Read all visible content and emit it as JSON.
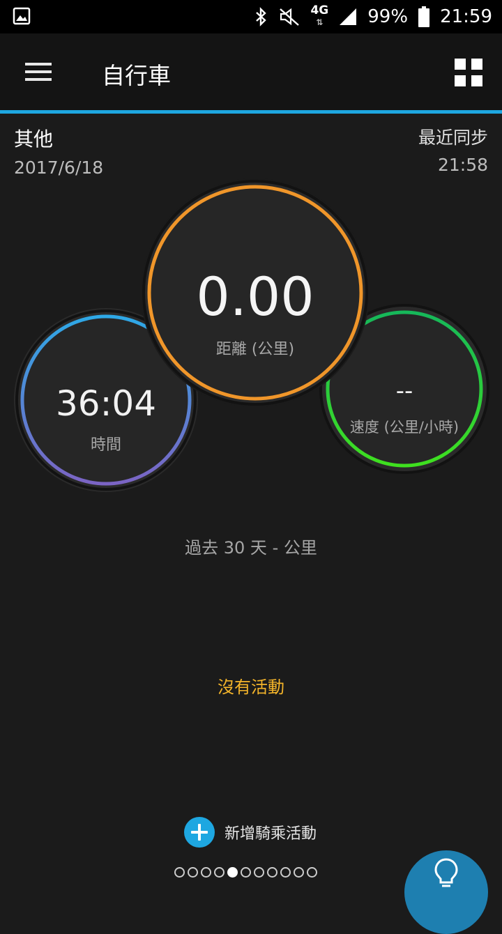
{
  "status_bar": {
    "network": "4G",
    "battery": "99%",
    "time": "21:59"
  },
  "app_bar": {
    "title": "自行車"
  },
  "summary": {
    "category": "其他",
    "date": "2017/6/18",
    "sync_label": "最近同步",
    "sync_time": "21:58"
  },
  "metrics": {
    "distance": {
      "value": "0.00",
      "label": "距離 (公里)"
    },
    "time": {
      "value": "36:04",
      "label": "時間"
    },
    "speed": {
      "value": "--",
      "label": "速度 (公里/小時)"
    }
  },
  "history": {
    "period_label": "過去 30 天 - 公里",
    "empty_message": "沒有活動"
  },
  "actions": {
    "add_activity": "新增騎乘活動"
  },
  "pager": {
    "total_pages": 11,
    "active_page": 5
  },
  "colors": {
    "accent": "#1ea7e1",
    "distance_ring": "#f0962a",
    "time_ring_top": "#2ea8e6",
    "time_ring_bottom": "#7b64c4",
    "speed_ring": "#22c860",
    "empty_text": "#f5b52a"
  }
}
